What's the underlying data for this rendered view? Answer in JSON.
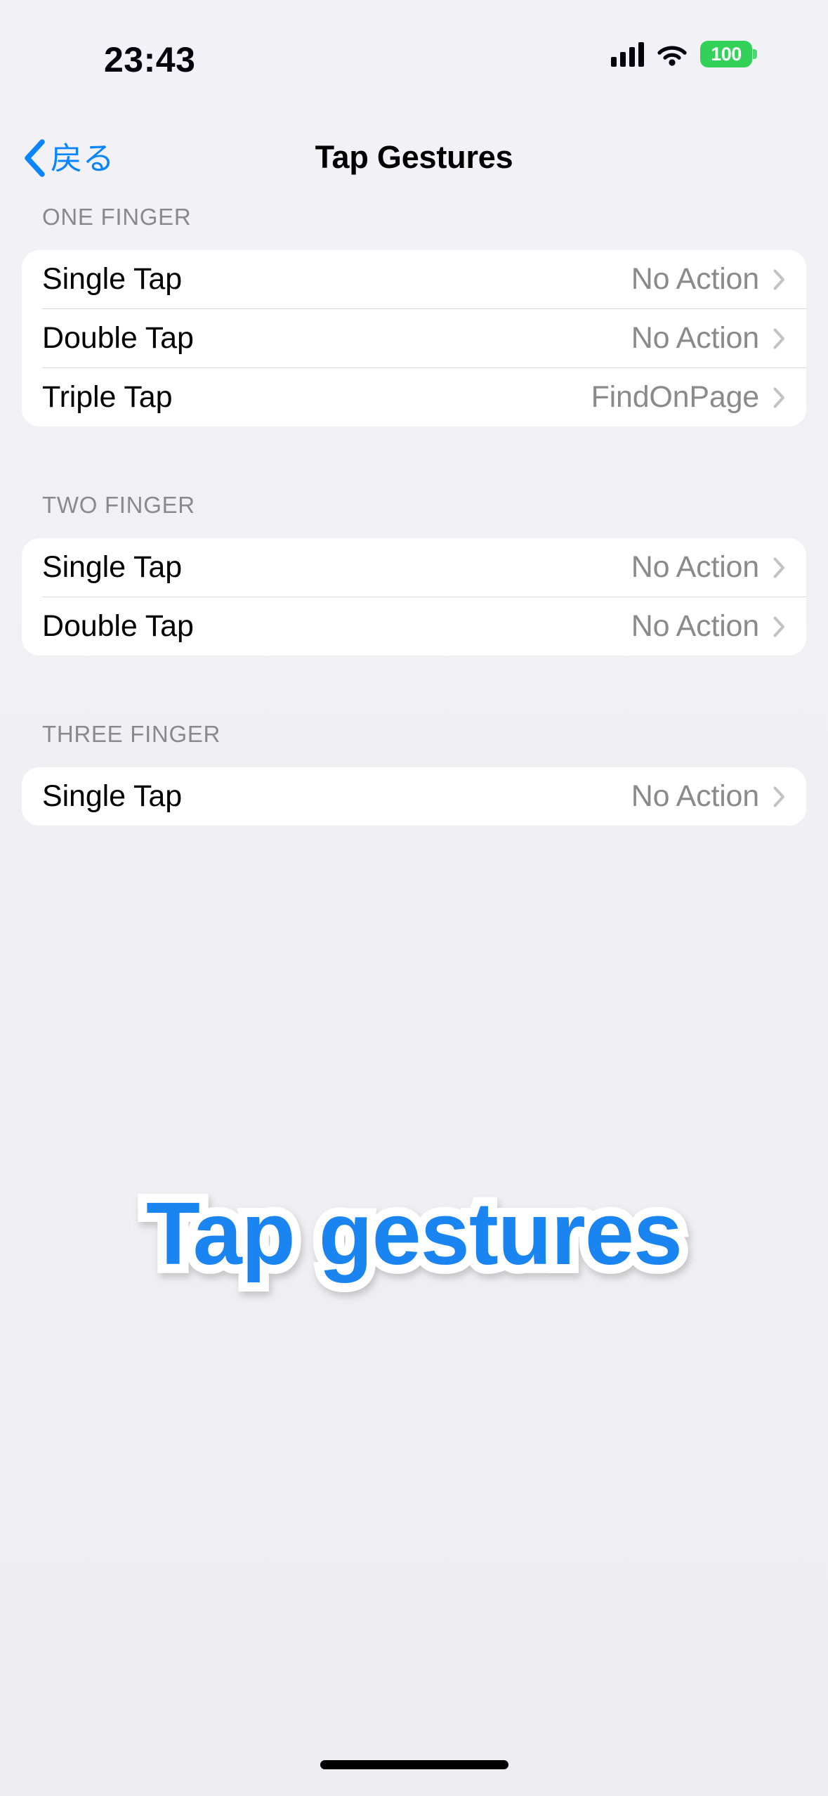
{
  "status_bar": {
    "time": "23:43",
    "battery_level": "100",
    "battery_color": "#32d158",
    "cellular_icon": "cellular-bars-icon",
    "wifi_icon": "wifi-icon",
    "battery_icon": "battery-icon"
  },
  "nav": {
    "back_label": "戻る",
    "back_icon": "chevron-left-icon",
    "title": "Tap Gestures",
    "accent_color": "#0a84ff"
  },
  "sections": [
    {
      "header": "ONE FINGER",
      "rows": [
        {
          "label": "Single Tap",
          "value": "No Action",
          "chevron": "chevron-right-icon"
        },
        {
          "label": "Double Tap",
          "value": "No Action",
          "chevron": "chevron-right-icon"
        },
        {
          "label": "Triple Tap",
          "value": "FindOnPage",
          "chevron": "chevron-right-icon"
        }
      ]
    },
    {
      "header": "TWO FINGER",
      "rows": [
        {
          "label": "Single Tap",
          "value": "No Action",
          "chevron": "chevron-right-icon"
        },
        {
          "label": "Double Tap",
          "value": "No Action",
          "chevron": "chevron-right-icon"
        }
      ]
    },
    {
      "header": "THREE FINGER",
      "rows": [
        {
          "label": "Single Tap",
          "value": "No Action",
          "chevron": "chevron-right-icon"
        }
      ]
    }
  ],
  "sticker": {
    "text": "Tap gestures",
    "fill_color": "#1a84f0",
    "outline_color": "#ffffff"
  },
  "colors": {
    "background": "#f1f1f5",
    "card": "#ffffff",
    "secondary_text": "#8a8a8e",
    "separator": "#d8d8dc"
  }
}
